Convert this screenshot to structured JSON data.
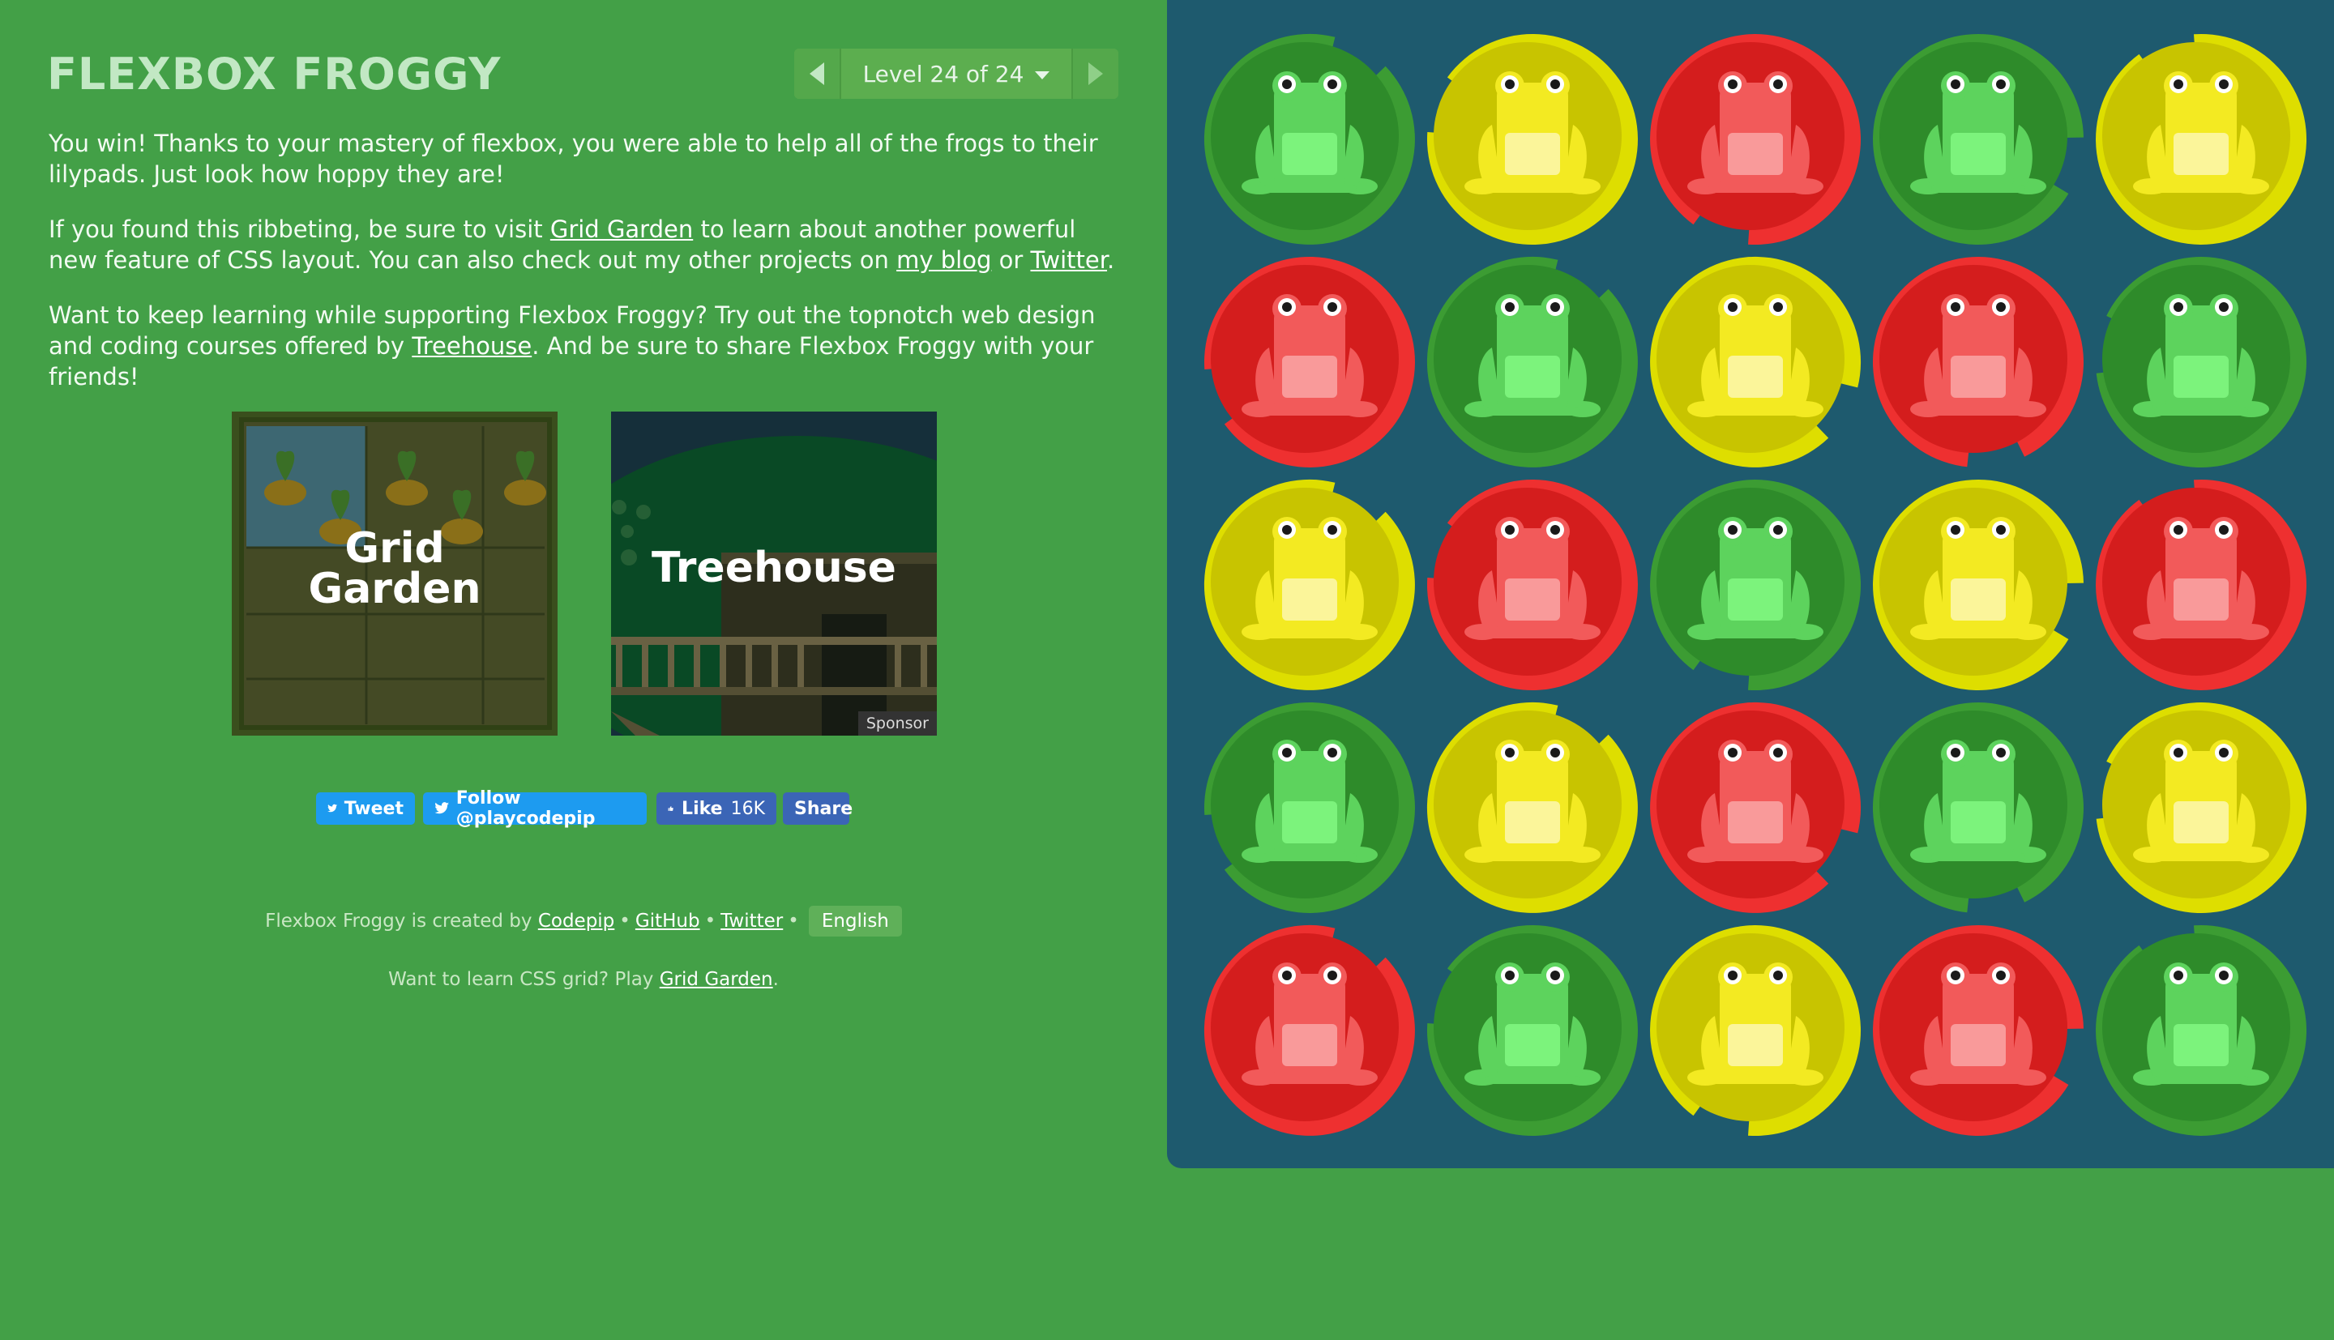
{
  "header": {
    "title": "FLEXBOX FROGGY",
    "level_text": "Level 24 of 24"
  },
  "content": {
    "p1": "You win! Thanks to your mastery of flexbox, you were able to help all of the frogs to their lilypads. Just look how hoppy they are!",
    "p2_before": "If you found this ribbeting, be sure to visit ",
    "p2_link1": "Grid Garden",
    "p2_mid": " to learn about another powerful new feature of CSS layout. You can also check out my other projects on ",
    "p2_link2": "my blog",
    "p2_or": " or ",
    "p2_link3": "Twitter",
    "p2_end": ".",
    "p3_before": "Want to keep learning while supporting Flexbox Froggy? Try out the topnotch web design and coding courses offered by ",
    "p3_link": "Treehouse",
    "p3_end": ". And be sure to share Flexbox Froggy with your friends!"
  },
  "cards": {
    "grid_garden_line1": "Grid",
    "grid_garden_line2": "Garden",
    "treehouse": "Treehouse",
    "sponsor": "Sponsor"
  },
  "social": {
    "tweet": "Tweet",
    "follow": "Follow @playcodepip",
    "like": "Like",
    "like_count": "16K",
    "share": "Share"
  },
  "footer": {
    "created_by": "Flexbox Froggy is created by ",
    "codepip": "Codepip",
    "github": "GitHub",
    "twitter": "Twitter",
    "sep": "•",
    "language": "English",
    "learn_grid": "Want to learn CSS grid? Play ",
    "grid_garden": "Grid Garden",
    "period": "."
  },
  "colors": {
    "green": {
      "pad": "#2e8b2a",
      "pad_dark": "#3c9c33",
      "frog": "#5dd35d",
      "frog_belly": "#7cf37c"
    },
    "yellow": {
      "pad": "#c8c400",
      "pad_dark": "#dede00",
      "frog": "#f3ea22",
      "frog_belly": "#fbf59a"
    },
    "red": {
      "pad": "#d41d1d",
      "pad_dark": "#ee3030",
      "frog": "#f25a5a",
      "frog_belly": "#f99a9a"
    }
  },
  "board": {
    "rows": [
      [
        "green",
        "yellow",
        "red",
        "green",
        "yellow"
      ],
      [
        "red",
        "green",
        "yellow",
        "red",
        "green"
      ],
      [
        "yellow",
        "red",
        "green",
        "yellow",
        "red"
      ],
      [
        "green",
        "yellow",
        "red",
        "green",
        "yellow"
      ],
      [
        "red",
        "green",
        "yellow",
        "red",
        "green"
      ]
    ]
  }
}
